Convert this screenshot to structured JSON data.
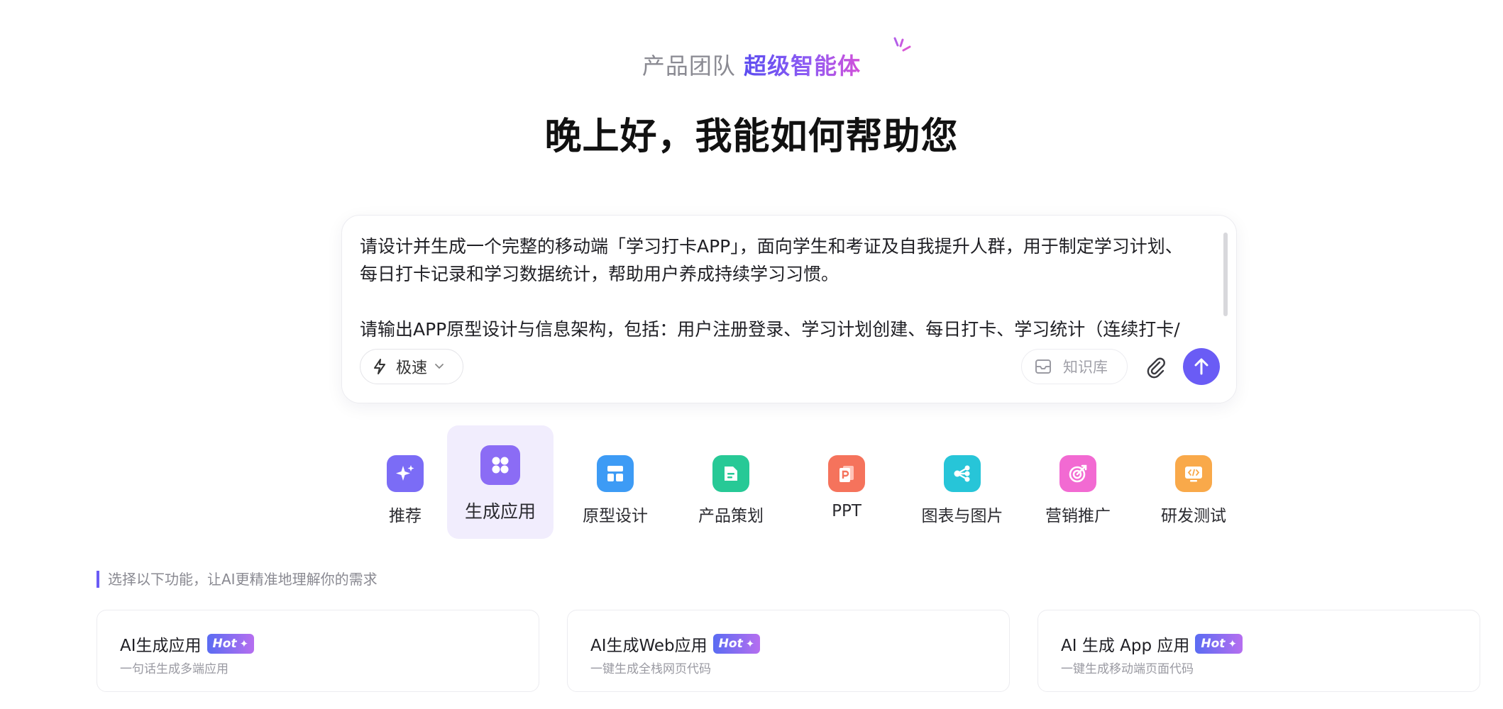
{
  "header": {
    "team_label": "产品团队",
    "super_label": "超级智能体",
    "greeting": "晚上好，我能如何帮助您"
  },
  "input": {
    "prompt_text": "请设计并生成一个完整的移动端「学习打卡APP」，面向学生和考证及自我提升人群，用于制定学习计划、每日打卡记录和学习数据统计，帮助用户养成持续学习习惯。\n\n请输出APP原型设计与信息架构，包括：用户注册登录、学习计划创建、每日打卡、学习统计（连续打卡/",
    "mode_label": "极速",
    "knowledge_label": "知识库"
  },
  "categories": [
    {
      "label": "推荐",
      "icon": "sparkle-icon",
      "color": "#7b6cf6",
      "active": false
    },
    {
      "label": "生成应用",
      "icon": "apps-grid-icon",
      "color": "#8b6cf5",
      "active": true
    },
    {
      "label": "原型设计",
      "icon": "layout-icon",
      "color": "#3d9bf5",
      "active": false
    },
    {
      "label": "产品策划",
      "icon": "document-icon",
      "color": "#27c996",
      "active": false
    },
    {
      "label": "PPT",
      "icon": "ppt-icon",
      "color": "#f5735c",
      "active": false
    },
    {
      "label": "图表与图片",
      "icon": "share-nodes-icon",
      "color": "#27c5d8",
      "active": false
    },
    {
      "label": "营销推广",
      "icon": "target-icon",
      "color": "#f26ad2",
      "active": false
    },
    {
      "label": "研发测试",
      "icon": "code-icon",
      "color": "#f9a94a",
      "active": false
    }
  ],
  "hint": "选择以下功能，让AI更精准地理解你的需求",
  "features": [
    {
      "title": "AI生成应用",
      "badge": "Hot",
      "desc": "一句话生成多端应用"
    },
    {
      "title": "AI生成Web应用",
      "badge": "Hot",
      "desc": "一键生成全栈网页代码"
    },
    {
      "title": "AI 生成 App 应用",
      "badge": "Hot",
      "desc": "一键生成移动端页面代码"
    }
  ]
}
